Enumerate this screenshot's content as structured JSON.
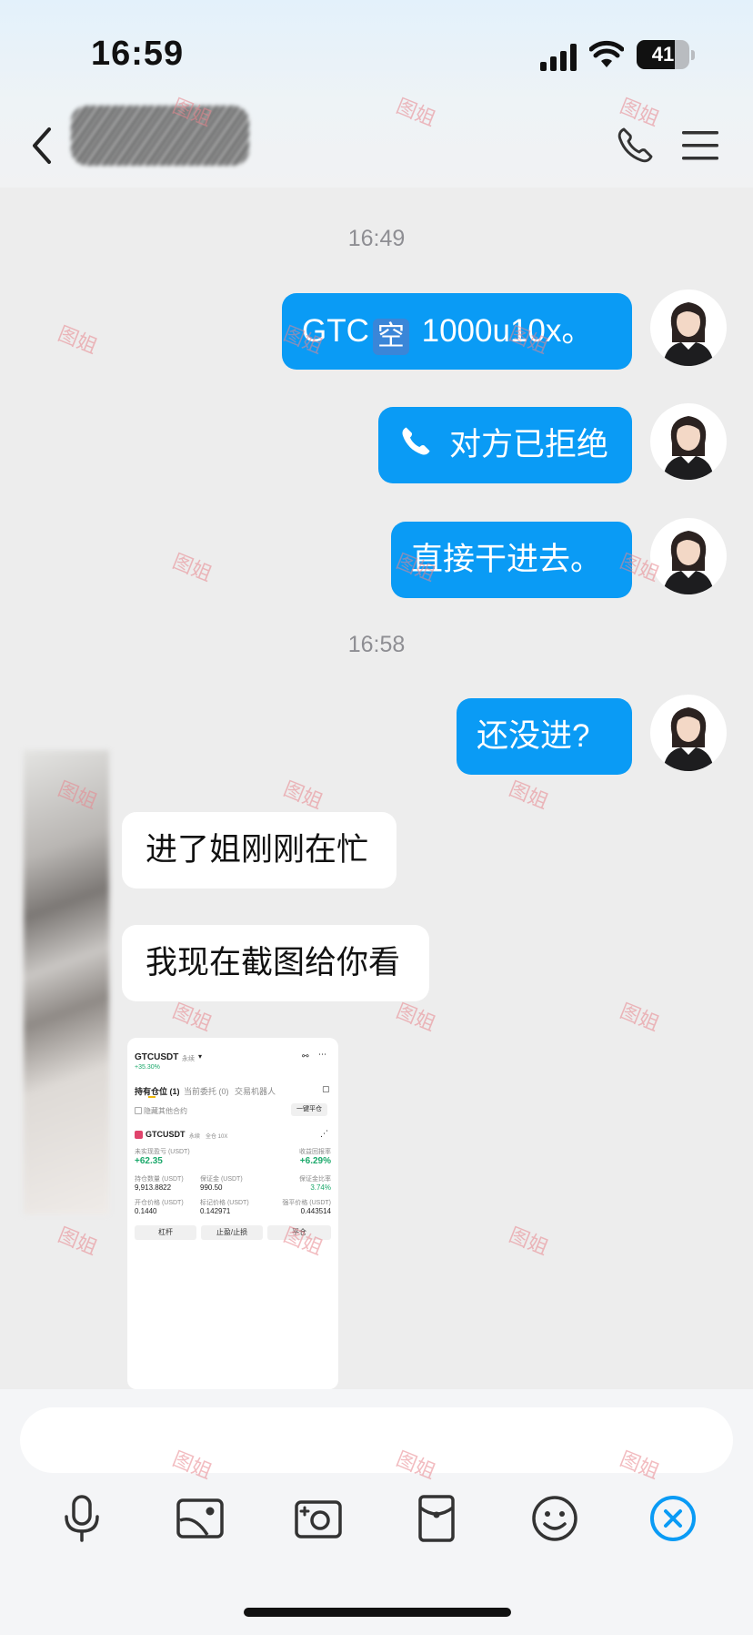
{
  "status_bar": {
    "time": "16:59",
    "battery": "41"
  },
  "header": {
    "icons": [
      "back-icon",
      "phone-icon",
      "menu-icon"
    ]
  },
  "chat": {
    "timestamps": [
      "16:49",
      "16:58"
    ],
    "outgoing": [
      {
        "prefix": "GTC",
        "emoji": "空",
        "suffix": " 1000u10x。"
      },
      {
        "text": "对方已拒绝",
        "icon": "phone-icon"
      },
      {
        "text": "直接干进去。"
      },
      {
        "text": "还没进?"
      }
    ],
    "incoming": [
      {
        "text": "进了姐刚刚在忙"
      },
      {
        "text": "我现在截图给你看"
      }
    ]
  },
  "screenshot": {
    "pair": "GTCUSDT",
    "perp_tag": "永续",
    "change": "+35.30%",
    "tabs": [
      "持有仓位 (1)",
      "当前委托 (0)",
      "交易机器人"
    ],
    "hide_other": "隐藏其他合约",
    "close_all": "一键平仓",
    "position_pair": "GTCUSDT",
    "position_tags": [
      "永续",
      "全仓 10X"
    ],
    "fields": [
      {
        "label": "未实现盈亏 (USDT)",
        "value": "+62.35"
      },
      {
        "label": "收益回报率",
        "value": "+6.29%"
      },
      {
        "label": "持仓数量 (USDT)",
        "value": "9,913.8822"
      },
      {
        "label": "保证金 (USDT)",
        "value": "990.50"
      },
      {
        "label": "保证金比率",
        "value": "3.74%"
      },
      {
        "label": "开仓价格 (USDT)",
        "value": "0.1440"
      },
      {
        "label": "标记价格 (USDT)",
        "value": "0.142971"
      },
      {
        "label": "强平价格 (USDT)",
        "value": "0.443514"
      }
    ],
    "buttons": [
      "杠杆",
      "止盈/止损",
      "平仓"
    ]
  },
  "input_bar": {
    "tools": [
      "microphone-icon",
      "image-icon",
      "camera-icon",
      "red-packet-icon",
      "emoji-icon",
      "close-icon"
    ]
  },
  "watermark": "图姐",
  "colors": {
    "accent": "#0a9bf5",
    "background": "#ededed",
    "positive": "#1aa86a"
  }
}
